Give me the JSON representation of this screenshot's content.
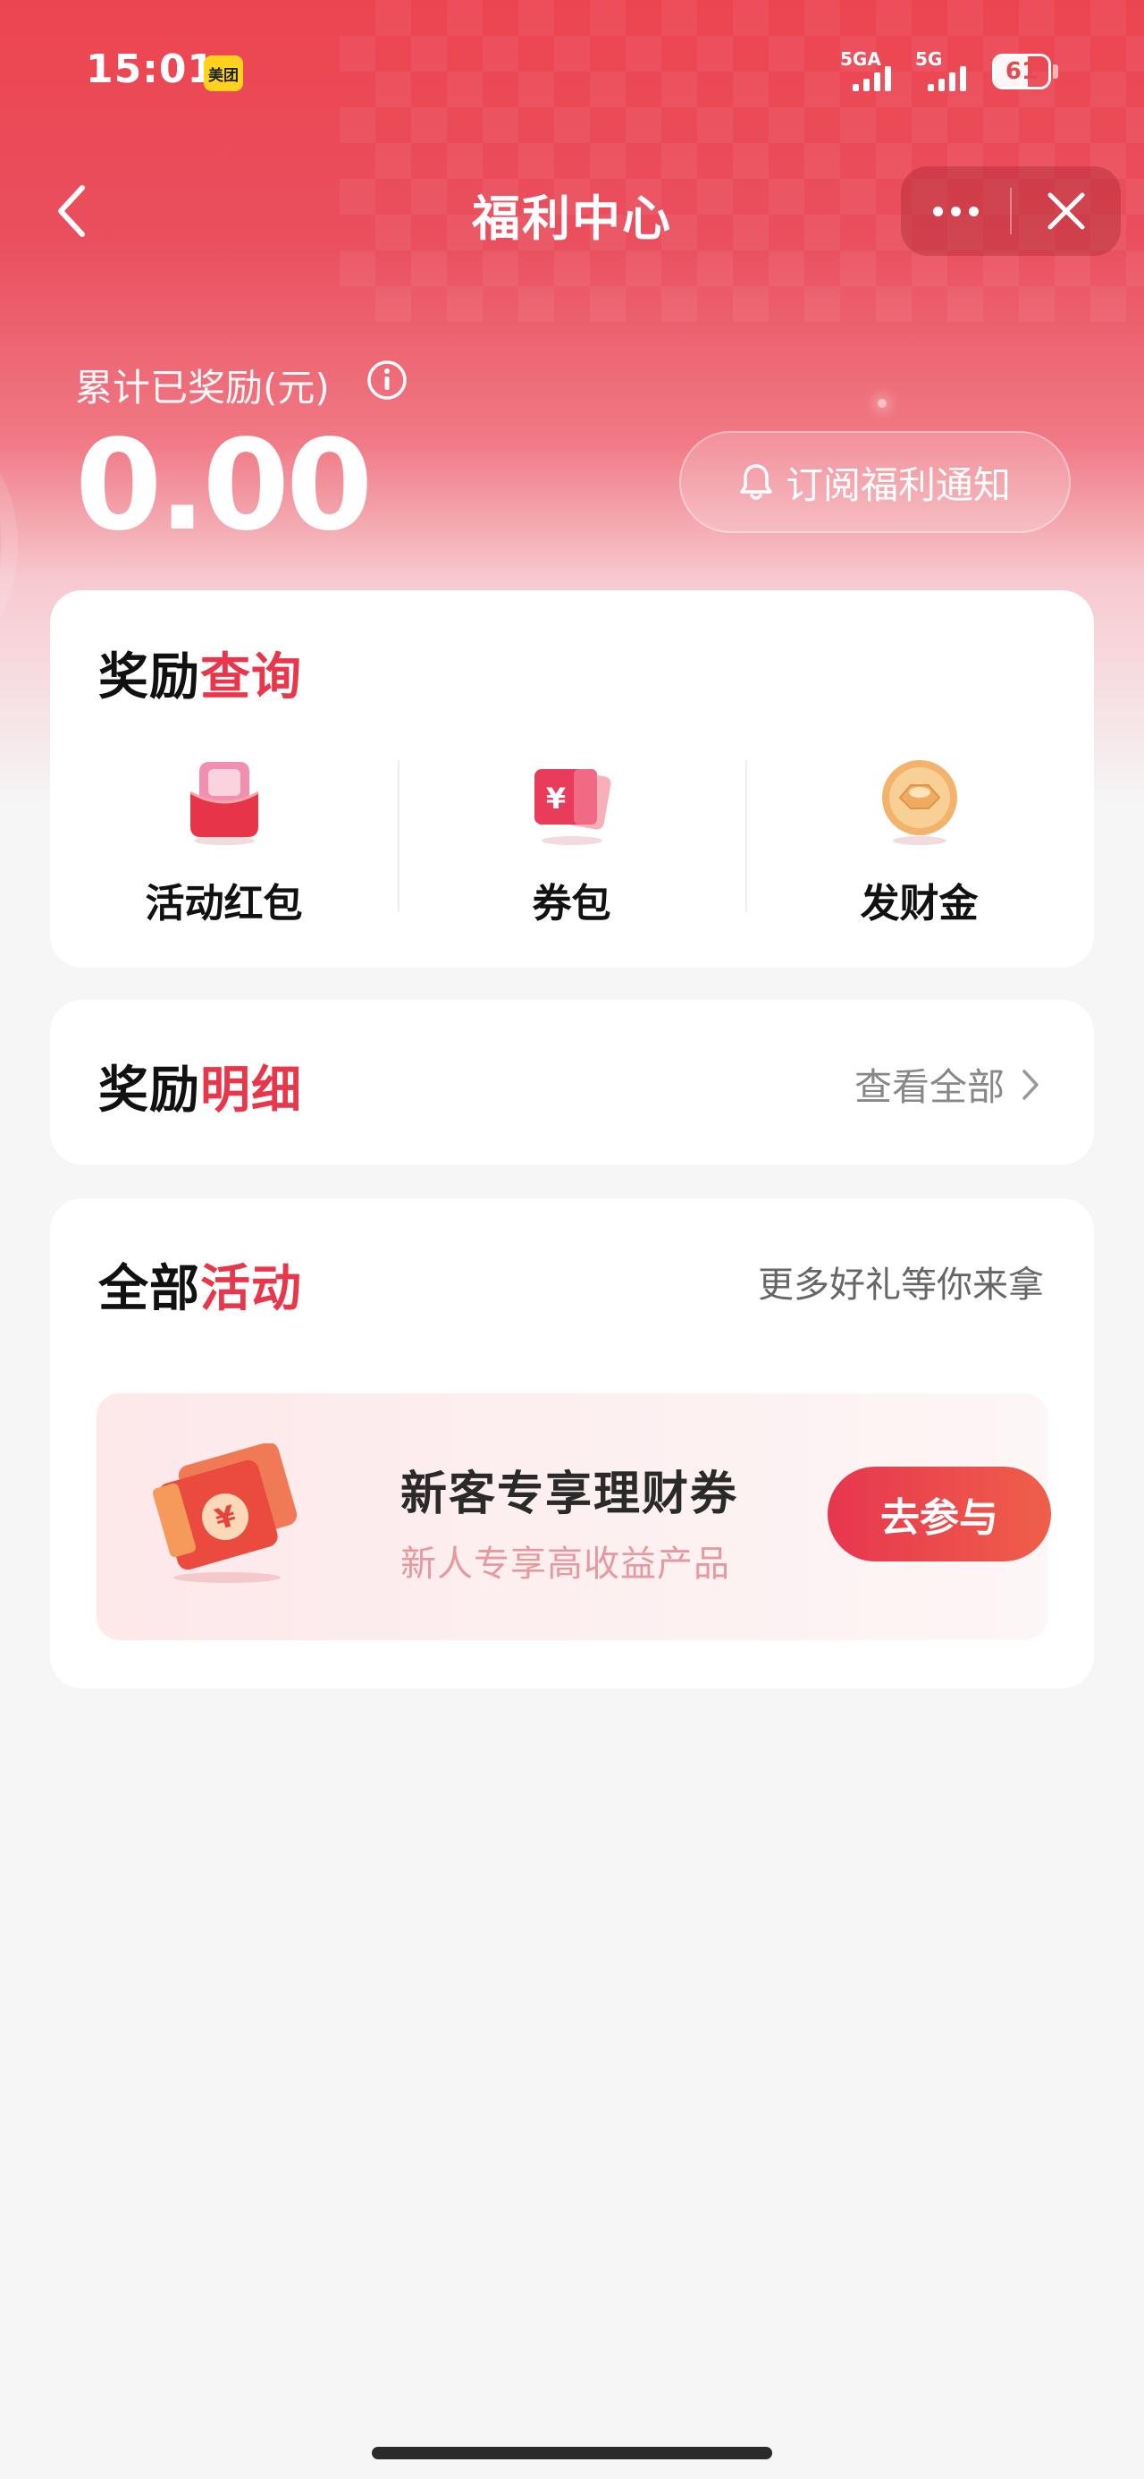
{
  "status_bar": {
    "time": "15:01",
    "app_badge": "美团",
    "signal_1_label": "5GA",
    "signal_2_label": "5G",
    "battery": "61",
    "battery_level": 0.61
  },
  "nav": {
    "title": "福利中心"
  },
  "reward_summary": {
    "label": "累计已奖励(元)",
    "value": "0.00",
    "subscribe_label": "订阅福利通知"
  },
  "reward_query": {
    "title_plain": "奖励",
    "title_highlight": "查询",
    "items": [
      {
        "label": "活动红包",
        "icon": "red-envelope-icon"
      },
      {
        "label": "券包",
        "icon": "coupon-icon"
      },
      {
        "label": "发财金",
        "icon": "gold-coin-icon"
      }
    ]
  },
  "reward_detail": {
    "title_plain": "奖励",
    "title_highlight": "明细",
    "view_all": "查看全部"
  },
  "activities": {
    "title_plain": "全部",
    "title_highlight": "活动",
    "subtitle": "更多好礼等你来拿",
    "promo": {
      "title": "新客专享理财券",
      "subtitle": "新人专享高收益产品",
      "button": "去参与",
      "icon_glyph": "¥"
    }
  },
  "colors": {
    "brand_red": "#e8364a",
    "hero_top": "#ec4550",
    "page_bg": "#f6f6f6"
  }
}
